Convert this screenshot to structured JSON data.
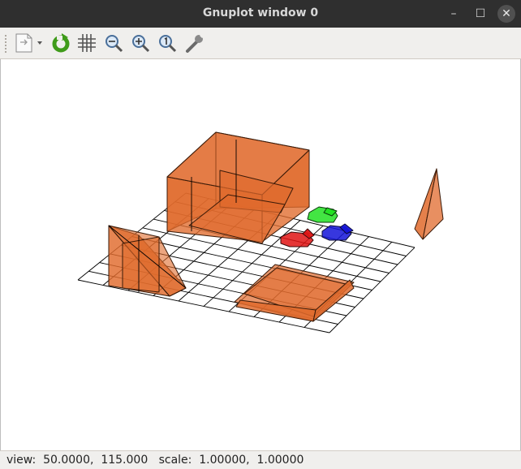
{
  "window": {
    "title": "Gnuplot window 0"
  },
  "window_controls": {
    "minimize": "–",
    "maximize": "☐",
    "close": "✕"
  },
  "toolbar": {
    "items": [
      {
        "name": "export",
        "icon": "document-export-icon"
      },
      {
        "name": "replot",
        "icon": "refresh-icon"
      },
      {
        "name": "grid",
        "icon": "grid-icon"
      },
      {
        "name": "zoom-previous",
        "icon": "zoom-out-icon"
      },
      {
        "name": "zoom-next",
        "icon": "zoom-in-icon"
      },
      {
        "name": "autoscale",
        "icon": "zoom-fit-icon"
      },
      {
        "name": "settings",
        "icon": "wrench-icon"
      }
    ]
  },
  "plot": {
    "fill_color": "#e06a2c",
    "object_colors": {
      "red": "#e01414",
      "green": "#22e022",
      "blue": "#1414d8"
    }
  },
  "status": {
    "text": "view:  50.0000,  115.000   scale:  1.00000,  1.00000"
  }
}
